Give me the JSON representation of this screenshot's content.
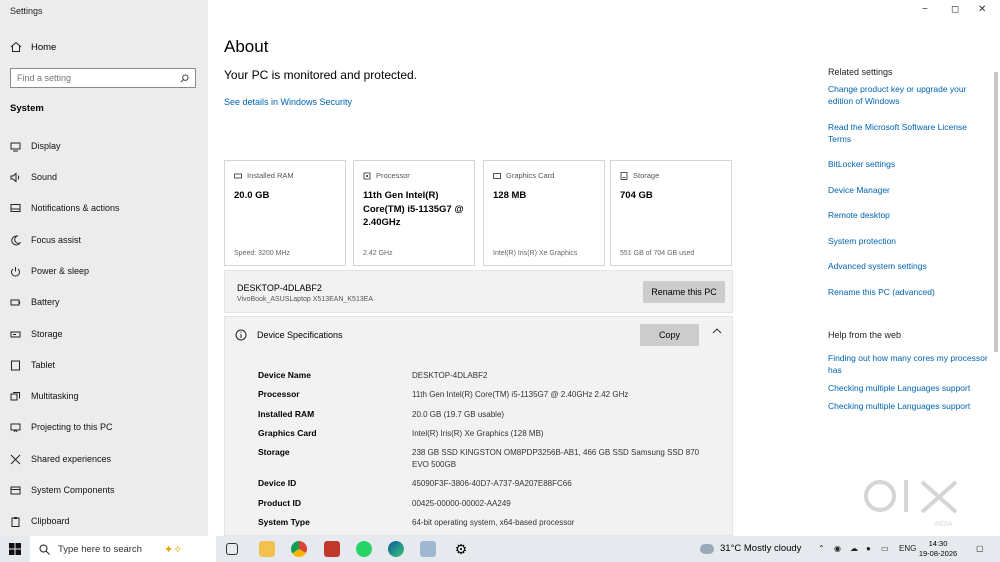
{
  "window": {
    "title": "Settings",
    "controls": [
      "−",
      "◻",
      "✕"
    ]
  },
  "sidebar": {
    "home": "Home",
    "search_placeholder": "Find a setting",
    "section": "System",
    "items": [
      {
        "label": "Display",
        "icon": "monitor-icon"
      },
      {
        "label": "Sound",
        "icon": "speaker-icon"
      },
      {
        "label": "Notifications & actions",
        "icon": "notification-icon"
      },
      {
        "label": "Focus assist",
        "icon": "moon-icon"
      },
      {
        "label": "Power & sleep",
        "icon": "power-icon"
      },
      {
        "label": "Battery",
        "icon": "battery-icon"
      },
      {
        "label": "Storage",
        "icon": "storage-icon"
      },
      {
        "label": "Tablet",
        "icon": "tablet-icon"
      },
      {
        "label": "Multitasking",
        "icon": "multitask-icon"
      },
      {
        "label": "Projecting to this PC",
        "icon": "project-icon"
      },
      {
        "label": "Shared experiences",
        "icon": "shared-icon"
      },
      {
        "label": "System Components",
        "icon": "components-icon"
      },
      {
        "label": "Clipboard",
        "icon": "clipboard-icon"
      }
    ]
  },
  "main": {
    "title": "About",
    "protection": "Your PC is monitored and protected.",
    "security_link": "See details in Windows Security",
    "cards": [
      {
        "title": "Installed RAM",
        "value": "20.0 GB",
        "sub": "Speed: 3200 MHz"
      },
      {
        "title": "Processor",
        "value": "11th Gen Intel(R) Core(TM) i5-1135G7 @ 2.40GHz",
        "sub": "2.42 GHz"
      },
      {
        "title": "Graphics Card",
        "value": "128 MB",
        "sub": "Intel(R) Iris(R) Xe Graphics"
      },
      {
        "title": "Storage",
        "value": "704 GB",
        "sub": "551 GB of 704 GB used"
      }
    ],
    "pc_name": "DESKTOP-4DLABF2",
    "pc_model": "VivoBook_ASUSLaptop X513EAN_K513EA",
    "rename_button": "Rename this PC",
    "spec_title": "Device Specifications",
    "copy_button": "Copy",
    "specs": [
      {
        "key": "Device Name",
        "value": "DESKTOP-4DLABF2"
      },
      {
        "key": "Processor",
        "value": "11th Gen Intel(R) Core(TM) i5-1135G7 @ 2.40GHz   2.42 GHz"
      },
      {
        "key": "Installed RAM",
        "value": "20.0 GB (19.7 GB usable)"
      },
      {
        "key": "Graphics Card",
        "value": "Intel(R) Iris(R) Xe Graphics (128 MB)"
      },
      {
        "key": "Storage",
        "value": "238 GB SSD KINGSTON OM8PDP3256B-AB1, 466 GB SSD Samsung SSD 870 EVO 500GB"
      },
      {
        "key": "Device ID",
        "value": "45090F3F-3806-40D7-A737-9A207E88FC66"
      },
      {
        "key": "Product ID",
        "value": "00425-00000-00002-AA249"
      },
      {
        "key": "System Type",
        "value": "64-bit operating system, x64-based processor"
      }
    ]
  },
  "related": {
    "heading": "Related settings",
    "links": [
      "Change product key or upgrade your edition of Windows",
      "Read the Microsoft Software License Terms",
      "BitLocker settings",
      "Device Manager",
      "Remote desktop",
      "System protection",
      "Advanced system settings",
      "Rename this PC (advanced)"
    ],
    "help_heading": "Help from the web",
    "help_links": [
      "Finding out how many cores my processor has",
      "Checking multiple Languages support",
      "Checking multiple Languages support"
    ]
  },
  "watermark": {
    "text": "OLX",
    "sub": "INDIA"
  },
  "taskbar": {
    "search": "Type here to search",
    "weather": "31°C  Mostly cloudy",
    "lang": "ENG",
    "time": "14:30",
    "date": "19-08-2026",
    "apps": [
      "taskview-icon",
      "file-explorer-icon",
      "chrome-icon",
      "app-icon",
      "whatsapp-icon",
      "edge-icon",
      "photos-icon",
      "settings-icon"
    ]
  },
  "colors": {
    "link": "#0063b1",
    "sidebar_bg": "#ececec",
    "button_bg": "#cccccc"
  }
}
